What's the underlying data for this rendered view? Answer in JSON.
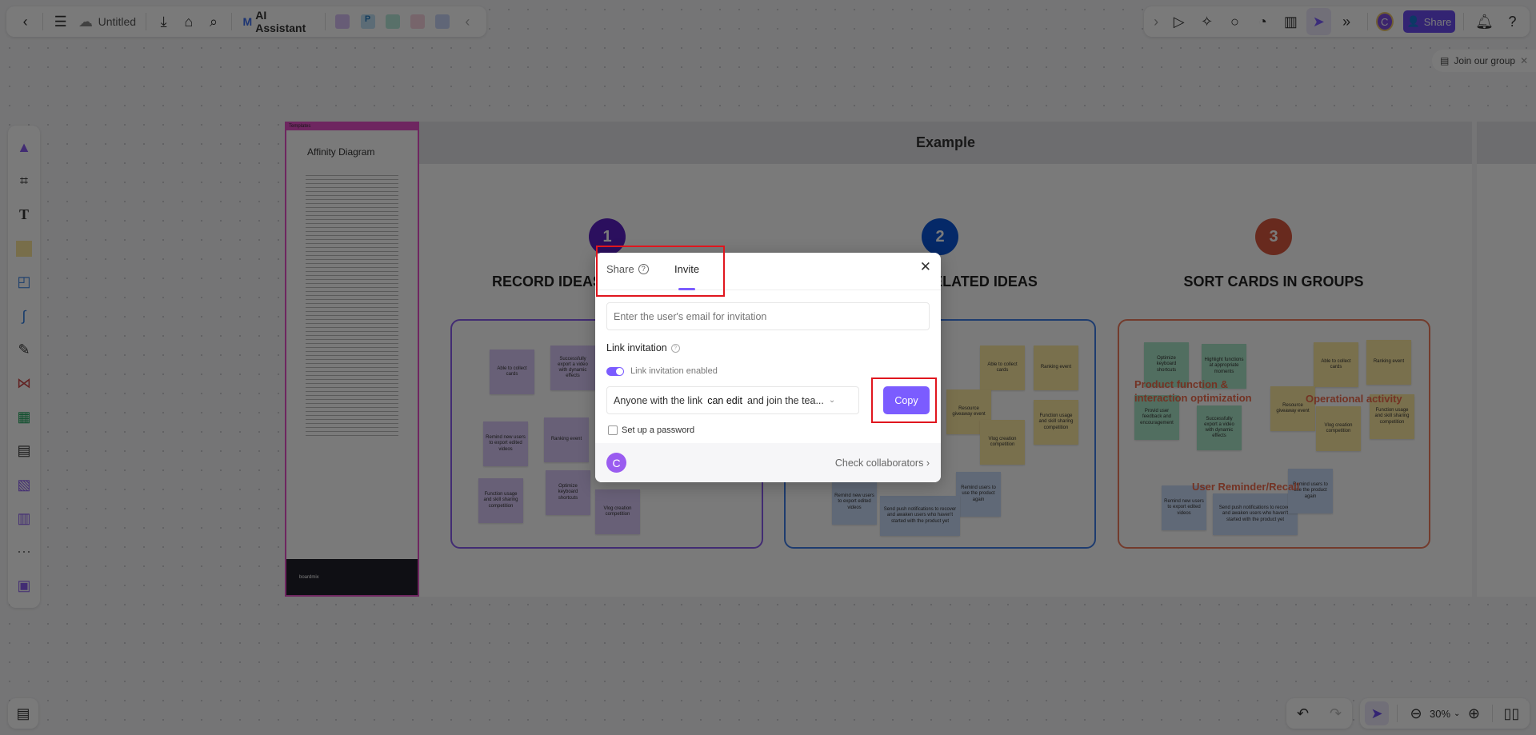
{
  "topbar": {
    "title": "Untitled",
    "ai_label": "AI Assistant",
    "share_label": "Share",
    "avatar_letter": "C"
  },
  "join_group": "Join our group",
  "zoom": {
    "level": "30%"
  },
  "template": {
    "tag": "Templates",
    "title": "Affinity Diagram",
    "footer": "boardmix"
  },
  "board": {
    "header": "Example",
    "steps": [
      {
        "num": "1",
        "title": "RECORD IDEAS USING STICKIES",
        "color": "#5a1fc4"
      },
      {
        "num": "2",
        "title": "LOOK FOR RELATED IDEAS",
        "color": "#0b56d8"
      },
      {
        "num": "3",
        "title": "SORT CARDS IN GROUPS",
        "color": "#d9583f"
      }
    ],
    "group1": [
      "Able to collect cards",
      "Successfully export a video with dynamic effects",
      "Remind new users to export edited videos",
      "Ranking event",
      "Function usage and skill sharing competition",
      "Optimize keyboard shortcuts",
      "Vlog creation competition"
    ],
    "group2": [
      "Able to collect cards",
      "Ranking event",
      "Resource giveaway event",
      "Function usage and skill sharing competition",
      "Vlog creation competition",
      "Remind new users to export edited videos",
      "Remind users to use the product again",
      "Send push notifications to recover and awaken users who haven't started with the product yet"
    ],
    "group3": {
      "cards_green": [
        "Optimize keyboard shortcuts",
        "Highlight functions at appropriate moments",
        "Provid user feedback and encouragement",
        "Successfully export a video with dynamic effects"
      ],
      "cards_yellow": [
        "Able to collect cards",
        "Ranking event",
        "Resource giveaway event",
        "Vlog creation competition",
        "Function usage and skill sharing competition"
      ],
      "cards_blue": [
        "Remind new users to export edited videos",
        "Send push notifications to recover and awaken users who haven't started with the product yet",
        "Remind users to use the product again"
      ],
      "labels": [
        "Product function & interaction optimization",
        "Operational activity",
        "User Reminder/Recall"
      ]
    }
  },
  "dialog": {
    "tabs": [
      {
        "label": "Share"
      },
      {
        "label": "Invite",
        "active": true
      }
    ],
    "email_placeholder": "Enter the user's email for invitation",
    "link_invitation_label": "Link invitation",
    "toggle_label": "Link invitation enabled",
    "toggle_on": true,
    "permission": {
      "prefix": "Anyone with the link",
      "role": "can edit",
      "suffix": "and join the tea..."
    },
    "copy_label": "Copy",
    "password_label": "Set up a password",
    "password_checked": false,
    "avatar_letter": "C",
    "collaborators_link": "Check collaborators"
  },
  "colors": {
    "accent": "#7b5cff",
    "highlight": "#e0161e"
  }
}
